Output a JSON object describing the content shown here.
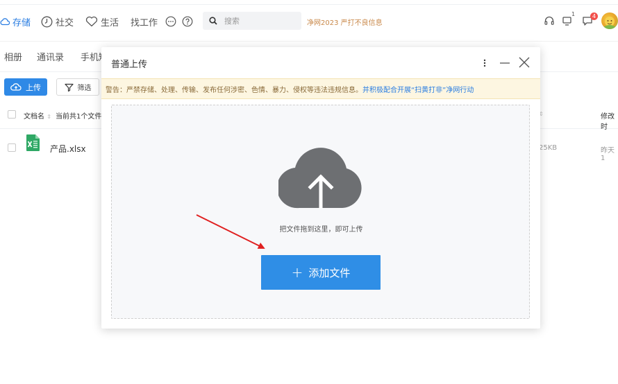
{
  "nav": {
    "items": [
      {
        "label": "存储",
        "icon": "cloud-icon",
        "active": true
      },
      {
        "label": "社交",
        "icon": "clock-icon",
        "active": false
      },
      {
        "label": "生活",
        "icon": "heart-icon",
        "active": false
      },
      {
        "label": "找工作",
        "icon": "",
        "active": false
      }
    ],
    "more_icon": "more-dots-icon",
    "help_icon": "help-icon",
    "search": {
      "placeholder": "搜索",
      "icon": "search-icon"
    },
    "notice": "净网2023 严打不良信息",
    "right_icons": [
      "headset-icon",
      "device-icon",
      "message-icon",
      "avatar"
    ],
    "device_badge": "1",
    "message_badge": "4"
  },
  "subtabs": [
    "相册",
    "通讯录",
    "手机短"
  ],
  "toolbar": {
    "upload_label": "上传",
    "filter_label": "筛选"
  },
  "table": {
    "headers": {
      "name": "文档名",
      "count": "当前共1个文件",
      "modified": "修改时"
    },
    "rows": [
      {
        "name": "产品.xlsx",
        "icon": "excel-file-icon",
        "size": "25KB",
        "date": "昨天 1"
      }
    ]
  },
  "modal": {
    "title": "普通上传",
    "warning": "警告：严禁存储、处理、传输、发布任何涉密、色情、暴力、侵权等违法违规信息。",
    "warning_link": "并积极配合开展“扫黄打非”净网行动",
    "drop_hint": "把文件拖到这里，即可上传",
    "add_button": "添加文件",
    "colors": {
      "accent": "#2f8ee6",
      "warning_bg": "#fdf6e1",
      "arrow": "#e02020"
    }
  }
}
